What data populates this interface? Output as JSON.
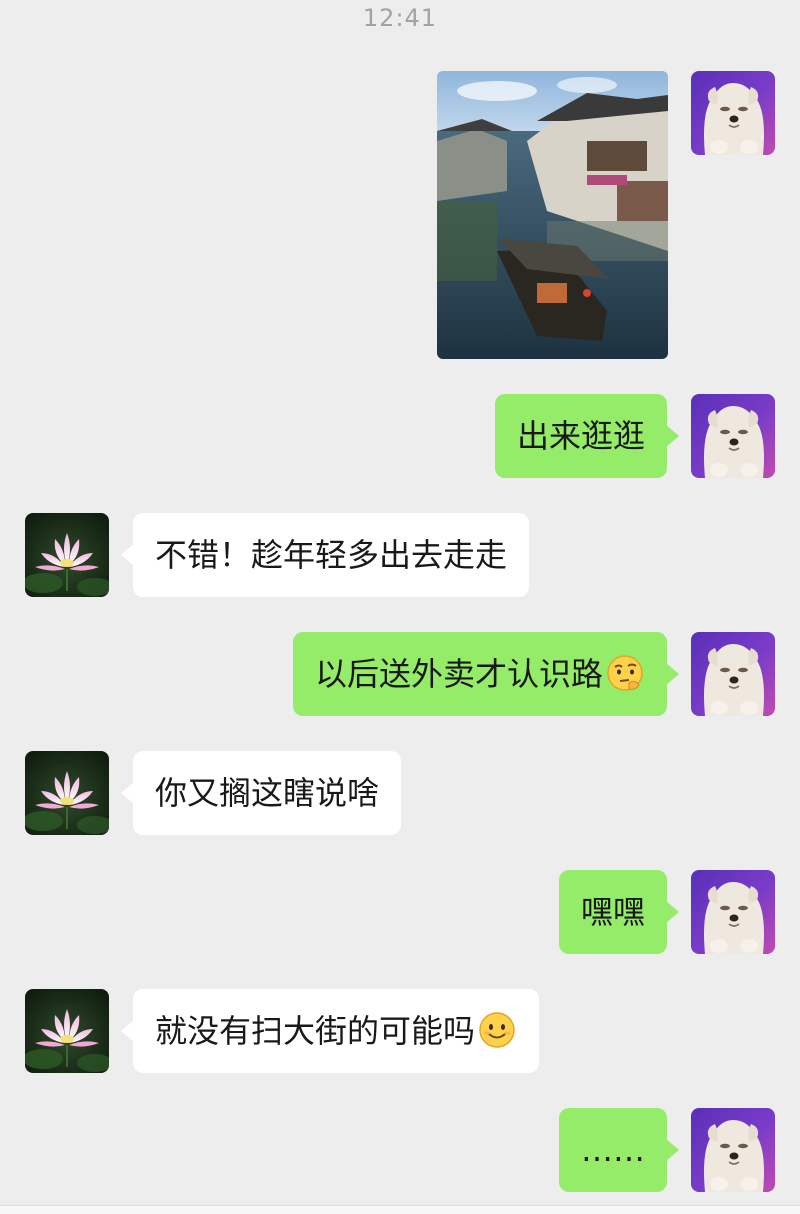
{
  "status": {
    "time": "12:41"
  },
  "colors": {
    "background": "#ededed",
    "sent_bubble": "#95ec69",
    "received_bubble": "#ffffff",
    "timestamp": "#a3a3a3"
  },
  "chat": {
    "messages": [
      {
        "sender": "me",
        "type": "image",
        "image_subject": "water-town-canal-with-boat"
      },
      {
        "sender": "me",
        "type": "text",
        "text": "出来逛逛"
      },
      {
        "sender": "them",
        "type": "text",
        "text": "不错！趁年轻多出去走走"
      },
      {
        "sender": "me",
        "type": "text",
        "text": "以后送外卖才认识路",
        "emoji": "thinking-emoji"
      },
      {
        "sender": "them",
        "type": "text",
        "text": "你又搁这瞎说啥"
      },
      {
        "sender": "me",
        "type": "text",
        "text": "嘿嘿"
      },
      {
        "sender": "them",
        "type": "text",
        "text": "就没有扫大街的可能吗",
        "emoji": "smile-emoji"
      },
      {
        "sender": "me",
        "type": "text",
        "text": "……"
      }
    ]
  },
  "avatars": {
    "me": "white-dog-avatar",
    "them": "lotus-flower-avatar"
  }
}
